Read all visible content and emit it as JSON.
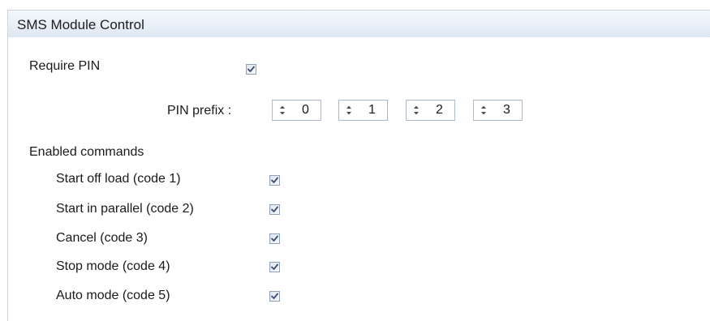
{
  "panel": {
    "title": "SMS Module Control"
  },
  "require_pin": {
    "label": "Require PIN",
    "checked": true
  },
  "pin_prefix": {
    "label": "PIN prefix :",
    "digits": [
      "0",
      "1",
      "2",
      "3"
    ]
  },
  "enabled_commands": {
    "heading": "Enabled commands",
    "items": [
      {
        "label": "Start off load (code 1)",
        "checked": true
      },
      {
        "label": "Start in parallel (code 2)",
        "checked": true
      },
      {
        "label": "Cancel (code 3)",
        "checked": true
      },
      {
        "label": "Stop mode (code 4)",
        "checked": true
      },
      {
        "label": "Auto mode (code 5)",
        "checked": true
      }
    ]
  },
  "icons": {
    "checkbox_check": "check-icon",
    "spinner_arrows": "spin-arrows-icon"
  },
  "colors": {
    "header_gradient_top": "#f4f8fc",
    "header_gradient_bottom": "#dde7f3",
    "border": "#c8d4e4",
    "checkmark": "#3a4e72"
  }
}
